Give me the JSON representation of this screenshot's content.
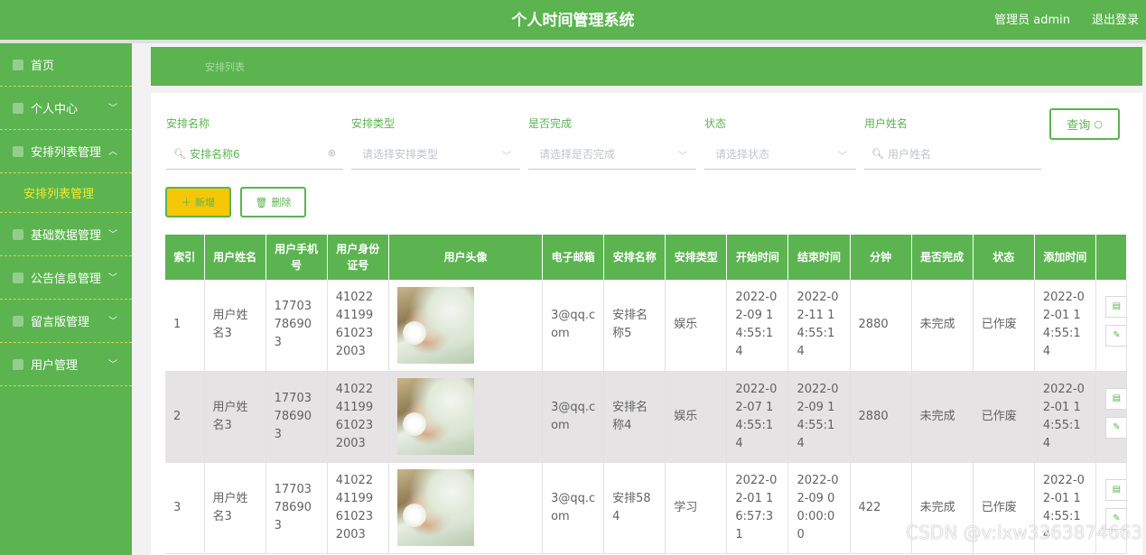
{
  "header": {
    "title": "个人时间管理系统",
    "admin": "管理员 admin",
    "logout": "退出登录"
  },
  "sidebar": {
    "items": [
      {
        "label": "首页",
        "icon": "home-icon"
      },
      {
        "label": "个人中心",
        "icon": "user-icon"
      },
      {
        "label": "安排列表管理",
        "icon": "list-icon"
      },
      {
        "label": "基础数据管理",
        "icon": "database-icon"
      },
      {
        "label": "公告信息管理",
        "icon": "notice-icon"
      },
      {
        "label": "留言版管理",
        "icon": "message-icon"
      },
      {
        "label": "用户管理",
        "icon": "users-icon"
      }
    ],
    "sub_active": "安排列表管理"
  },
  "breadcrumb": "安排列表",
  "filters": {
    "name_label": "安排名称",
    "name_value": "安排名称6",
    "type_label": "安排类型",
    "type_placeholder": "请选择安排类型",
    "done_label": "是否完成",
    "done_placeholder": "请选择是否完成",
    "status_label": "状态",
    "status_placeholder": "请选择状态",
    "user_label": "用户姓名",
    "user_placeholder": "用户姓名"
  },
  "buttons": {
    "query": "查询",
    "add": "新增",
    "delete": "删除"
  },
  "table": {
    "headers": [
      "索引",
      "用户姓名",
      "用户手机号",
      "用户身份证号",
      "用户头像",
      "电子邮箱",
      "安排名称",
      "安排类型",
      "开始时间",
      "结束时间",
      "分钟",
      "是否完成",
      "状态",
      "添加时间"
    ],
    "rows": [
      [
        "1",
        "用户姓名3",
        "17703786903",
        "410224119961023 2003",
        "",
        "3@qq.com",
        "安排名称5",
        "娱乐",
        "2022-02-09 14:55:14",
        "2022-02-11 14:55:14",
        "2880",
        "未完成",
        "已作废",
        "2022-02-01 14:55:14"
      ],
      [
        "2",
        "用户姓名3",
        "17703786903",
        "410224119961023 2003",
        "",
        "3@qq.com",
        "安排名称4",
        "娱乐",
        "2022-02-07 14:55:14",
        "2022-02-09 14:55:14",
        "2880",
        "未完成",
        "已作废",
        "2022-02-01 14:55:14"
      ],
      [
        "3",
        "用户姓名3",
        "17703786903",
        "410224119961023 2003",
        "",
        "3@qq.com",
        "安排584",
        "学习",
        "2022-02-01 16:57:31",
        "2022-02-09 00:00:00",
        "422",
        "未完成",
        "已作废",
        "2022-02-01 14:55:14"
      ]
    ]
  },
  "watermark": "CSDN @v:lxw3363874663",
  "colors": {
    "primary": "#5bb450",
    "accent": "#f5c707",
    "sub_text": "#f5e92b"
  }
}
